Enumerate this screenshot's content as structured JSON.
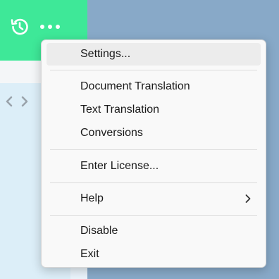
{
  "app": {
    "history_icon": "history-icon",
    "more_icon": "more-horizontal-icon",
    "code_icon": "code-brackets-icon"
  },
  "menu": {
    "settings": "Settings...",
    "document_translation": "Document Translation",
    "text_translation": "Text Translation",
    "conversions": "Conversions",
    "enter_license": "Enter License...",
    "help": "Help",
    "disable": "Disable",
    "exit": "Exit",
    "submenu_icon": "chevron-right-icon"
  },
  "colors": {
    "accent_green": "#3ee898",
    "desktop_blue": "#88a9c8",
    "menu_bg": "#f9f9f9",
    "hover_bg": "#ececec"
  }
}
